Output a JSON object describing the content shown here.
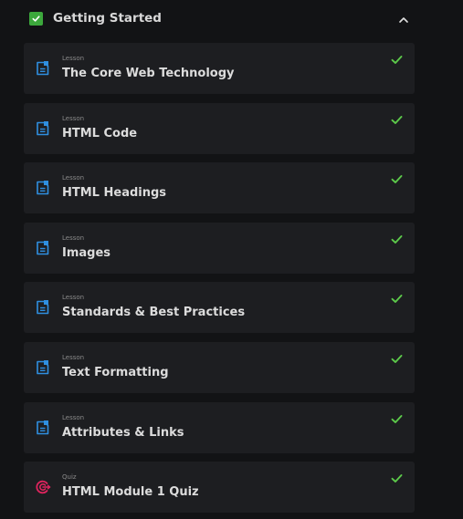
{
  "section": {
    "title": "Getting Started",
    "accent": "#3ca83c"
  },
  "items": [
    {
      "type": "Lesson",
      "title": "The Core Web Technology",
      "icon": "document-icon"
    },
    {
      "type": "Lesson",
      "title": "HTML Code",
      "icon": "document-icon"
    },
    {
      "type": "Lesson",
      "title": "HTML Headings",
      "icon": "document-icon"
    },
    {
      "type": "Lesson",
      "title": "Images",
      "icon": "document-icon"
    },
    {
      "type": "Lesson",
      "title": "Standards & Best Practices",
      "icon": "document-icon"
    },
    {
      "type": "Lesson",
      "title": "Text Formatting",
      "icon": "document-icon"
    },
    {
      "type": "Lesson",
      "title": "Attributes & Links",
      "icon": "document-icon"
    },
    {
      "type": "Quiz",
      "title": "HTML Module 1 Quiz",
      "icon": "quiz-target-icon"
    }
  ],
  "colors": {
    "lesson_icon": "#2f8fe0",
    "quiz_icon": "#e0245e",
    "complete_check": "#5cc94a"
  }
}
